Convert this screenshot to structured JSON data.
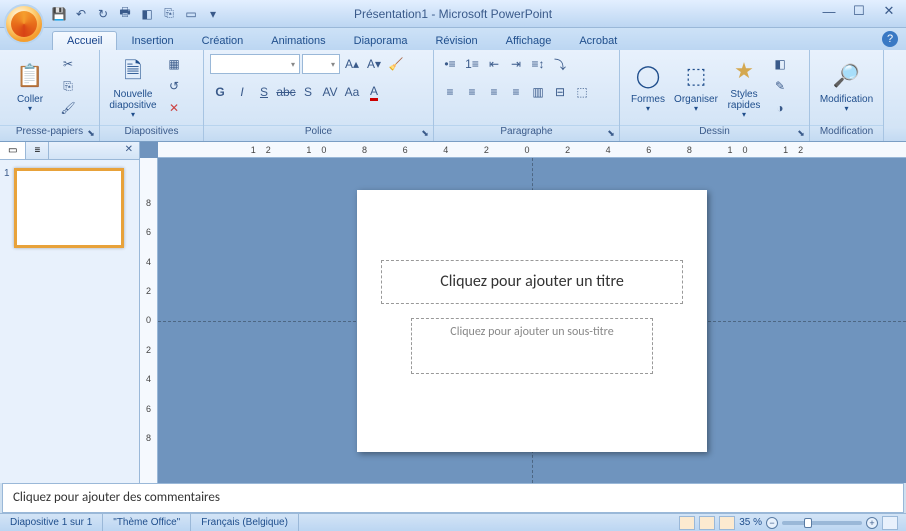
{
  "titlebar": {
    "title": "Présentation1 - Microsoft PowerPoint"
  },
  "tabs": {
    "items": [
      "Accueil",
      "Insertion",
      "Création",
      "Animations",
      "Diaporama",
      "Révision",
      "Affichage",
      "Acrobat"
    ],
    "active_index": 0
  },
  "ribbon": {
    "clipboard": {
      "label": "Presse-papiers",
      "paste": "Coller"
    },
    "slides": {
      "label": "Diapositives",
      "new_slide": "Nouvelle diapositive"
    },
    "font": {
      "label": "Police",
      "name": "",
      "size": ""
    },
    "paragraph": {
      "label": "Paragraphe"
    },
    "drawing": {
      "label": "Dessin",
      "shapes": "Formes",
      "arrange": "Organiser",
      "quick_styles": "Styles rapides"
    },
    "editing": {
      "label": "Modification",
      "editing": "Modification"
    }
  },
  "ruler": {
    "h": [
      "12",
      "10",
      "8",
      "6",
      "4",
      "2",
      "0",
      "2",
      "4",
      "6",
      "8",
      "10",
      "12"
    ],
    "v": [
      "8",
      "6",
      "4",
      "2",
      "0",
      "2",
      "4",
      "6",
      "8"
    ]
  },
  "panel": {
    "tab_outline": "",
    "tab_slides": "",
    "thumb_number": "1"
  },
  "slide": {
    "title_placeholder": "Cliquez pour ajouter un titre",
    "subtitle_placeholder": "Cliquez pour ajouter un sous-titre"
  },
  "notes": {
    "placeholder": "Cliquez pour ajouter des commentaires"
  },
  "statusbar": {
    "slide_info": "Diapositive 1 sur 1",
    "theme": "\"Thème Office\"",
    "language": "Français (Belgique)",
    "zoom": "35 %"
  }
}
